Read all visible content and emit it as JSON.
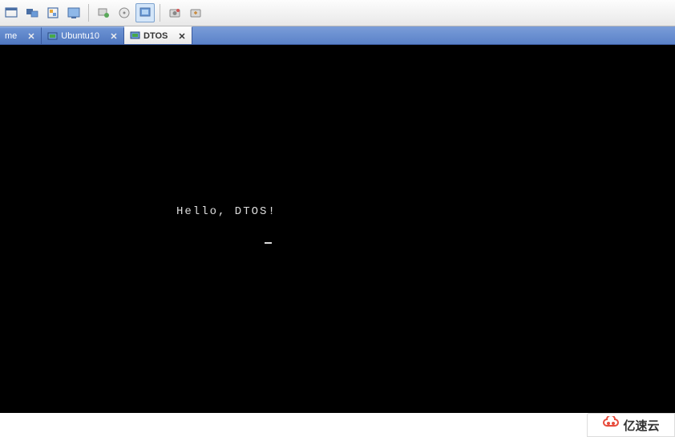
{
  "toolbar": {
    "groups": [
      {
        "items": [
          "fullscreen-icon",
          "multi-monitor-icon",
          "unity-icon",
          "console-icon"
        ]
      },
      {
        "items": [
          "power-icon",
          "cdrom-icon",
          "network-icon"
        ]
      },
      {
        "items": [
          "snapshot-icon",
          "revert-icon"
        ]
      }
    ]
  },
  "tabs": [
    {
      "id": "home",
      "label": "me",
      "active": false,
      "closable": true,
      "has_vm_icon": false
    },
    {
      "id": "ubuntu",
      "label": "Ubuntu10",
      "active": false,
      "closable": true,
      "has_vm_icon": true
    },
    {
      "id": "dtos",
      "label": "DTOS",
      "active": true,
      "closable": true,
      "has_vm_icon": true
    }
  ],
  "console": {
    "output": "Hello, DTOS!",
    "cursor_visible": true
  },
  "watermark": {
    "text": "亿速云"
  }
}
